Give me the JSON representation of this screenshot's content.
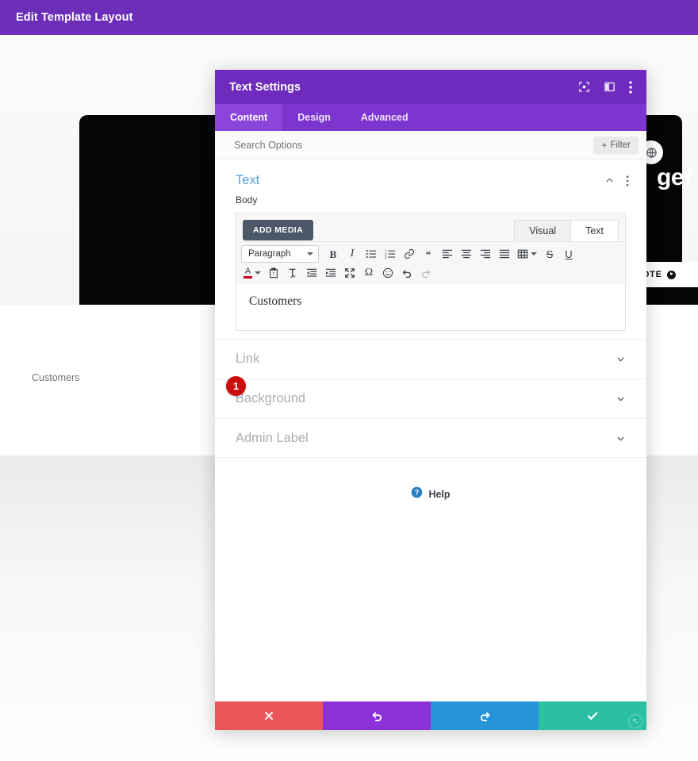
{
  "topbar": {
    "title": "Edit Template Layout",
    "bg": "#6c2eb9"
  },
  "canvas": {
    "hero_heading": "get st",
    "globe_icon": "globe-icon",
    "quote_button": {
      "label": "A QUOTE",
      "arrow_icon": "play-circle-icon"
    },
    "customers_label": "Customers"
  },
  "modal": {
    "title": "Text Settings",
    "header_bg": "#6e2bbd",
    "header_icons": [
      {
        "name": "focus-icon"
      },
      {
        "name": "layout-panel-icon"
      },
      {
        "name": "kebab-menu-icon"
      }
    ],
    "tabs": [
      {
        "label": "Content",
        "active": true
      },
      {
        "label": "Design",
        "active": false
      },
      {
        "label": "Advanced",
        "active": false
      }
    ],
    "search": {
      "placeholder": "Search Options",
      "value": ""
    },
    "filter_button": {
      "plus": "+",
      "label": "Filter"
    },
    "section": {
      "name": "Text",
      "accent": "#5a9fd4",
      "collapse_icon": "chevron-up-icon",
      "menu_icon": "kebab-menu-icon"
    },
    "field": {
      "label": "Body",
      "add_media": "ADD MEDIA",
      "editor_tabs": [
        {
          "label": "Visual",
          "active": true
        },
        {
          "label": "Text",
          "active": false
        }
      ],
      "format_select": {
        "value": "Paragraph"
      },
      "toolbar_row1": [
        "bold-icon",
        "italic-icon",
        "bulleted-list-icon",
        "numbered-list-icon",
        "link-icon",
        "blockquote-icon",
        "align-left-icon",
        "align-center-icon",
        "align-right-icon",
        "align-justify-icon",
        "table-icon",
        "strikethrough-icon",
        "underline-icon"
      ],
      "toolbar_row2": [
        "text-color-icon",
        "paste-as-text-icon",
        "clear-formatting-icon",
        "outdent-icon",
        "indent-icon",
        "fullscreen-icon",
        "special-character-icon",
        "emoji-icon",
        "undo-icon",
        "redo-icon"
      ],
      "content": "Customers",
      "badge": "1",
      "badge_color": "#cc0d0d"
    },
    "collapsed_sections": [
      {
        "name": "Link",
        "icon": "chevron-down-icon"
      },
      {
        "name": "Background",
        "icon": "chevron-down-icon"
      },
      {
        "name": "Admin Label",
        "icon": "chevron-down-icon"
      }
    ],
    "help": {
      "label": "Help",
      "icon": "help-circle-icon",
      "color": "#2d7fc1"
    },
    "footer_buttons": [
      {
        "name": "cancel",
        "icon": "close-icon",
        "color": "#e8565a"
      },
      {
        "name": "undo",
        "icon": "undo-icon",
        "color": "#8b31d8"
      },
      {
        "name": "redo",
        "icon": "redo-icon",
        "color": "#2793d8"
      },
      {
        "name": "save",
        "icon": "check-icon",
        "color": "#2bbfa4"
      }
    ]
  }
}
